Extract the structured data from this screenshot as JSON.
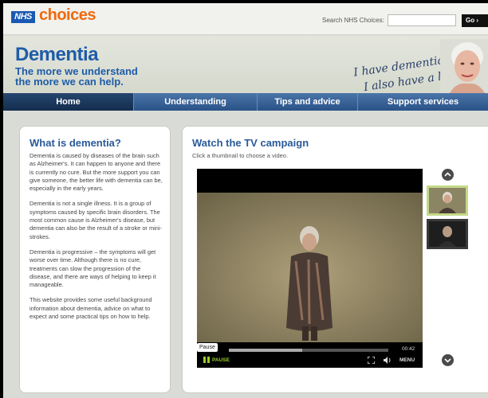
{
  "header": {
    "nhs_logo": "NHS",
    "choices_logo": "choices",
    "search_label": "Search NHS Choices:",
    "search_value": "",
    "go_label": "Go ›"
  },
  "banner": {
    "title": "Dementia",
    "tagline": "The more we understand the more we can help.",
    "handwriting_line1": "I have dementia",
    "handwriting_line2": "I also have a life."
  },
  "nav": {
    "items": [
      {
        "label": "Home",
        "active": true
      },
      {
        "label": "Understanding",
        "active": false
      },
      {
        "label": "Tips and advice",
        "active": false
      },
      {
        "label": "Support services",
        "active": false
      }
    ]
  },
  "left_panel": {
    "heading": "What is dementia?",
    "paragraphs": [
      "Dementia is caused by diseases of the brain such as Alzheimer's. It can happen to anyone and there is currently no cure. But the more support you can give someone, the better life with dementia can be, especially in the early years.",
      "Dementia is not a single illness. It is a group of symptoms caused by specific brain disorders. The most common cause is Alzheimer's disease, but dementia can also be the result of a stroke or mini-strokes.",
      "Dementia is progressive – the symptoms will get worse over time. Although there is no cure, treatments can slow the progression of the disease, and there are ways of helping to keep it manageable.",
      "This website provides some useful background information about dementia, advice on what to expect and some practical tips on how to help."
    ]
  },
  "right_panel": {
    "heading": "Watch the TV campaign",
    "subheading": "Click a thumbnail to choose a video."
  },
  "player": {
    "tooltip": "Pause",
    "pause_label": "PAUSE",
    "time": "00:42",
    "menu_label": "MENU",
    "progress": 0.46
  },
  "colors": {
    "brand_blue": "#1e5ca8",
    "nav_blue": "#2b5a90",
    "accent_orange": "#f06a0c",
    "player_green": "#9bcc28"
  }
}
